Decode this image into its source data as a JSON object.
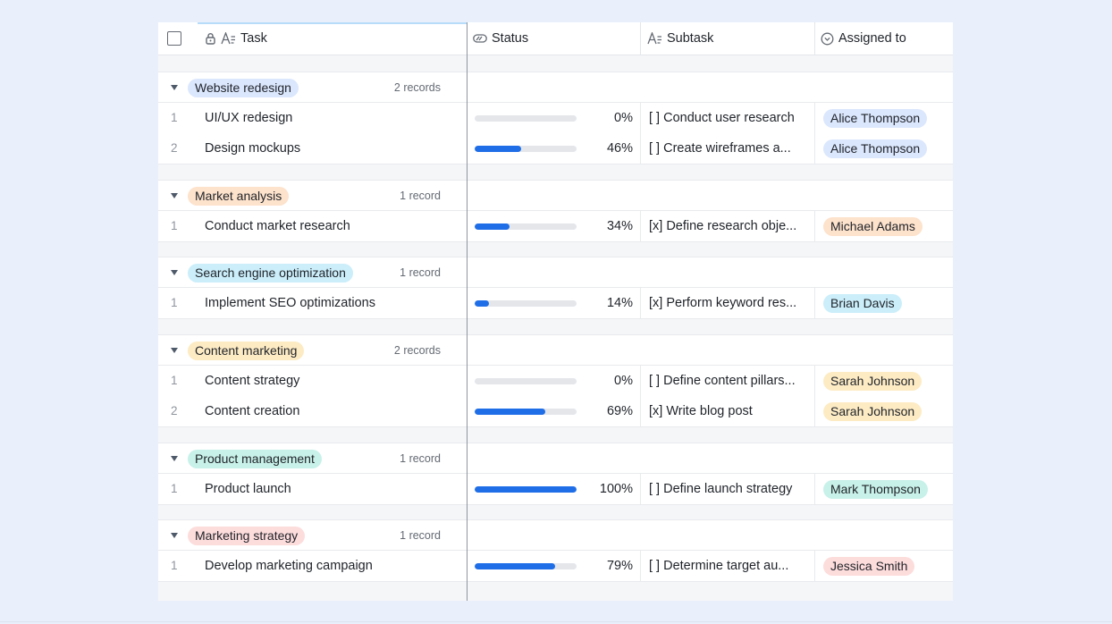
{
  "header": {
    "task_label": "Task",
    "status_label": "Status",
    "subtask_label": "Subtask",
    "assigned_label": "Assigned to"
  },
  "colors": {
    "blue": "#dbe7fd",
    "orange": "#fde2cc",
    "cyan": "#cbeefa",
    "yellow": "#fdebc4",
    "teal": "#c8f1e9",
    "pink": "#fddcdc",
    "progress": "#1f6ee8"
  },
  "groups": [
    {
      "name": "Website redesign",
      "count": "2 records",
      "color": "blue",
      "rows": [
        {
          "num": "1",
          "task": "UI/UX redesign",
          "progress": 0,
          "pct": "0%",
          "subtask": "[ ] Conduct user research",
          "person": "Alice Thompson"
        },
        {
          "num": "2",
          "task": "Design mockups",
          "progress": 46,
          "pct": "46%",
          "subtask": "[ ] Create wireframes a...",
          "person": "Alice Thompson"
        }
      ]
    },
    {
      "name": "Market analysis",
      "count": "1 record",
      "color": "orange",
      "rows": [
        {
          "num": "1",
          "task": "Conduct market research",
          "progress": 34,
          "pct": "34%",
          "subtask": "[x] Define research obje...",
          "person": "Michael Adams"
        }
      ]
    },
    {
      "name": "Search engine optimization",
      "count": "1 record",
      "color": "cyan",
      "rows": [
        {
          "num": "1",
          "task": "Implement SEO optimizations",
          "progress": 14,
          "pct": "14%",
          "subtask": "[x] Perform keyword res...",
          "person": "Brian Davis"
        }
      ]
    },
    {
      "name": "Content marketing",
      "count": "2 records",
      "color": "yellow",
      "rows": [
        {
          "num": "1",
          "task": "Content strategy",
          "progress": 0,
          "pct": "0%",
          "subtask": "[ ] Define content pillars...",
          "person": "Sarah Johnson"
        },
        {
          "num": "2",
          "task": "Content creation",
          "progress": 69,
          "pct": "69%",
          "subtask": "[x] Write blog post",
          "person": "Sarah Johnson"
        }
      ]
    },
    {
      "name": "Product management",
      "count": "1 record",
      "color": "teal",
      "rows": [
        {
          "num": "1",
          "task": "Product launch",
          "progress": 100,
          "pct": "100%",
          "subtask": "[ ] Define launch strategy",
          "person": "Mark Thompson"
        }
      ]
    },
    {
      "name": "Marketing strategy",
      "count": "1 record",
      "color": "pink",
      "rows": [
        {
          "num": "1",
          "task": "Develop marketing campaign",
          "progress": 79,
          "pct": "79%",
          "subtask": "[ ] Determine target au...",
          "person": "Jessica Smith"
        }
      ]
    }
  ]
}
